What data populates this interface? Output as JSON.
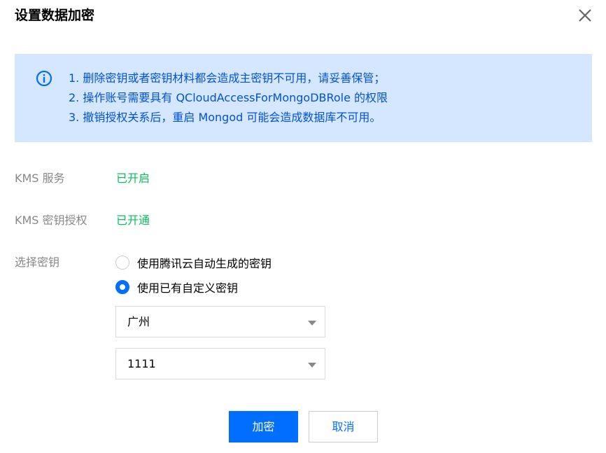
{
  "dialog": {
    "title": "设置数据加密",
    "close_icon": "close-icon"
  },
  "notice": {
    "icon": "info-circle-icon",
    "lines": [
      "1. 删除密钥或者密钥材料都会造成主密钥不可用，请妥善保管；",
      "2. 操作账号需要具有 QCloudAccessForMongoDBRole 的权限",
      "3. 撤销授权关系后，重启 Mongod 可能会造成数据库不可用。"
    ]
  },
  "rows": {
    "kms_service": {
      "label": "KMS 服务",
      "value": "已开启"
    },
    "kms_auth": {
      "label": "KMS 密钥授权",
      "value": "已开通"
    },
    "select_key": {
      "label": "选择密钥"
    }
  },
  "radio_options": [
    {
      "label": "使用腾讯云自动生成的密钥",
      "checked": false
    },
    {
      "label": "使用已有自定义密钥",
      "checked": true
    }
  ],
  "selects": {
    "region": {
      "value": "广州"
    },
    "key": {
      "value": "1111"
    }
  },
  "buttons": {
    "encrypt": "加密",
    "cancel": "取消"
  },
  "colors": {
    "accent": "#006eff",
    "notice_bg": "#d5e7ff",
    "notice_text": "#0052d9",
    "success": "#0abf5b",
    "label": "#888888"
  }
}
